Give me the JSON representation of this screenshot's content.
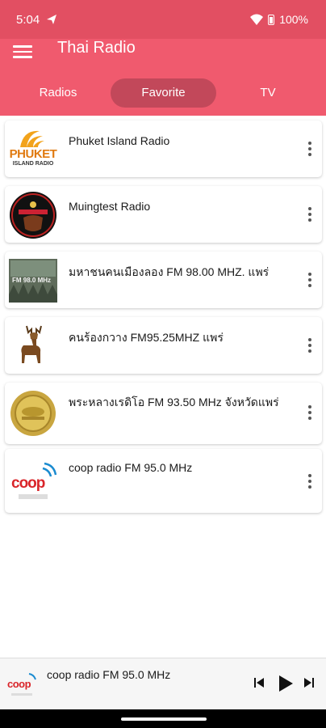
{
  "status_bar": {
    "time": "5:04",
    "battery": "100%"
  },
  "app_bar": {
    "title": "Thai Radio"
  },
  "tabs": [
    {
      "label": "Radios"
    },
    {
      "label": "Favorite"
    },
    {
      "label": "TV"
    }
  ],
  "stations": [
    {
      "name": "Phuket Island Radio",
      "logo": "phuket-island-radio-logo",
      "logo_text": "PHUKET",
      "logo_subtext": "ISLAND RADIO"
    },
    {
      "name": "Muingtest Radio",
      "logo": "muingtest-radio-logo"
    },
    {
      "name": "มหาชนคนเมืองลอง FM 98.00 MHZ. แพร่",
      "logo": "mahachon-fm-logo",
      "logo_text": "FM 98.0 MHz"
    },
    {
      "name": "คนร้องกวาง FM95.25MHZ แพร่",
      "logo": "deer-logo"
    },
    {
      "name": "พระหลางเรดิโอ  FM 93.50 MHz จังหวัดแพร่",
      "logo": "gold-seal-logo"
    },
    {
      "name": "coop radio FM 95.0 MHz",
      "logo": "coop-radio-logo",
      "logo_text": "coop"
    }
  ],
  "player": {
    "now_playing": "coop radio FM 95.0 MHz",
    "logo_text": "coop"
  },
  "colors": {
    "status_bar": "#e24f62",
    "app_bar": "#f05a6e",
    "active_tab": "#c2485a"
  }
}
